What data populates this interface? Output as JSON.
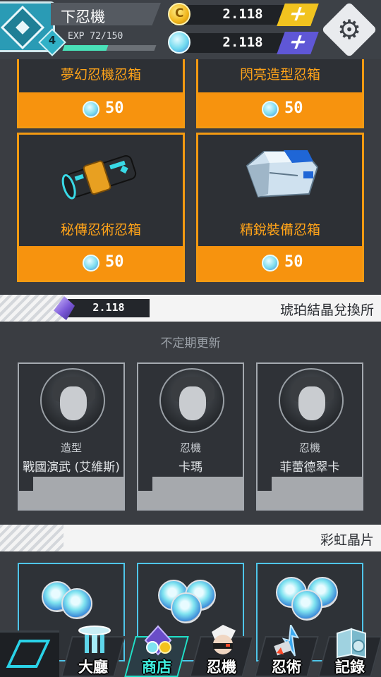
{
  "player": {
    "name": "下忍機",
    "level": "4",
    "exp_text": "EXP 72/150",
    "exp_fraction": 0.48
  },
  "currencies": {
    "gold": "2.118",
    "crystal": "2.118"
  },
  "chests": [
    {
      "title": "夢幻忍機忍箱",
      "price": "50"
    },
    {
      "title": "閃亮造型忍箱",
      "price": "50"
    },
    {
      "title": "秘傳忍術忍箱",
      "price": "50"
    },
    {
      "title": "精銳裝備忍箱",
      "price": "50"
    }
  ],
  "amber_section": {
    "count": "2.118",
    "title": "琥珀結晶兌換所",
    "note": "不定期更新"
  },
  "characters": [
    {
      "type": "造型",
      "name": "戰國演武 (艾維斯)"
    },
    {
      "type": "忍機",
      "name": "卡瑪"
    },
    {
      "type": "忍機",
      "name": "菲蕾德翠卡"
    }
  ],
  "rainbow_section": {
    "title": "彩虹晶片"
  },
  "nav": [
    {
      "label": "大廳",
      "icon": "lobby-icon"
    },
    {
      "label": "商店",
      "icon": "shop-icon"
    },
    {
      "label": "忍機",
      "icon": "ninja-icon"
    },
    {
      "label": "忍術",
      "icon": "skill-icon"
    },
    {
      "label": "記錄",
      "icon": "record-icon"
    }
  ],
  "colors": {
    "accent_orange": "#f7930e",
    "accent_cyan": "#2ad3e8",
    "background": "#3a3d42"
  }
}
